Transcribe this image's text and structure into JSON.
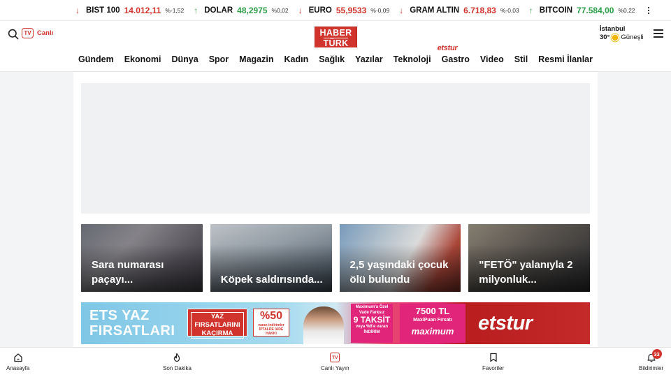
{
  "ticker": [
    {
      "name": "BIST 100",
      "value": "14.012,11",
      "change": "%-1,52",
      "dir": "down"
    },
    {
      "name": "DOLAR",
      "value": "48,2975",
      "change": "%0,02",
      "dir": "up"
    },
    {
      "name": "EURO",
      "value": "55,9533",
      "change": "%-0,09",
      "dir": "down"
    },
    {
      "name": "GRAM ALTIN",
      "value": "6.718,83",
      "change": "%-0,03",
      "dir": "down"
    },
    {
      "name": "BITCOIN",
      "value": "77.584,00",
      "change": "%0,22",
      "dir": "up"
    }
  ],
  "header": {
    "tv_label": "TV",
    "live_label": "Canlı",
    "logo_line1": "HABER",
    "logo_line2": "TÜRK",
    "weather_city": "İstanbul",
    "weather_temp": "30°",
    "weather_condition": "Güneşli"
  },
  "nav": {
    "items": [
      "Gündem",
      "Ekonomi",
      "Dünya",
      "Spor",
      "Magazin",
      "Kadın",
      "Sağlık",
      "Yazılar",
      "Teknoloji",
      "Gastro",
      "Video",
      "Stil",
      "Resmi İlanlar"
    ],
    "gastro_sponsor": "etstur"
  },
  "cards": [
    {
      "title": "Sara numarası paçayı..."
    },
    {
      "title": "Köpek saldırısında..."
    },
    {
      "title": "2,5 yaşındaki çocuk ölü bulundu"
    },
    {
      "title": "\"FETÖ\" yalanıyla 2 milyonluk..."
    }
  ],
  "banner": {
    "headline": "ETS YAZ FIRSATLARI",
    "box1": "YAZ FIRSATLARINI KAÇIRMA",
    "box2_big": "%50",
    "box2_small": "varan indirimler",
    "box2_note": "İPTALDE İADE HAKKI",
    "box3_line1": "Maximum'a Özel Vade Farksız",
    "box3_big": "9 TAKSİT",
    "box3_line2": "veya %8'e varan",
    "box3_line3": "İNDİRİM",
    "box4_big": "7500 TL",
    "box4_small": "MaxiPuan Fırsatı",
    "box4_brand": "maximum",
    "brand": "etstur"
  },
  "bottom_nav": [
    {
      "label": "Anasayfa",
      "icon": "home-icon"
    },
    {
      "label": "Son Dakika",
      "icon": "flame-icon"
    },
    {
      "label": "Canlı Yayın",
      "icon": "tv-icon"
    },
    {
      "label": "Favoriler",
      "icon": "bookmark-icon"
    },
    {
      "label": "Bildirimler",
      "icon": "bell-icon",
      "badge": "33"
    }
  ],
  "colors": {
    "accent": "#d0342c",
    "down": "#d0342c",
    "up": "#2e9e48"
  }
}
